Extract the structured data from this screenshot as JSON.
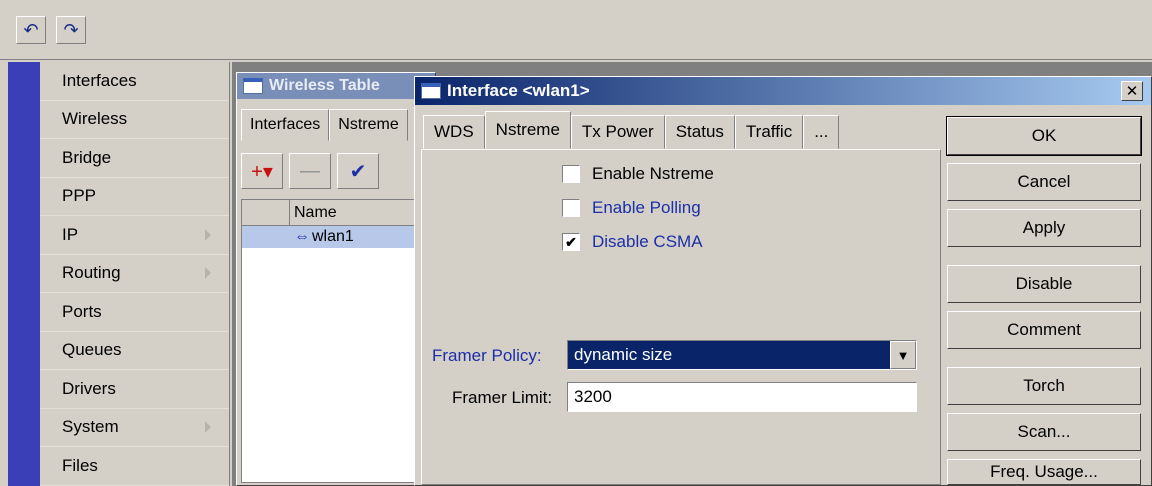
{
  "toolbar": {
    "undo_icon": "undo-icon",
    "redo_icon": "redo-icon",
    "undo_glyph": "↶",
    "redo_glyph": "↷"
  },
  "sidebar": {
    "items": [
      {
        "label": "Interfaces",
        "submenu": false
      },
      {
        "label": "Wireless",
        "submenu": false
      },
      {
        "label": "Bridge",
        "submenu": false
      },
      {
        "label": "PPP",
        "submenu": false
      },
      {
        "label": "IP",
        "submenu": true
      },
      {
        "label": "Routing",
        "submenu": true
      },
      {
        "label": "Ports",
        "submenu": false
      },
      {
        "label": "Queues",
        "submenu": false
      },
      {
        "label": "Drivers",
        "submenu": false
      },
      {
        "label": "System",
        "submenu": true
      },
      {
        "label": "Files",
        "submenu": false
      }
    ]
  },
  "wireless_table": {
    "title": "Wireless Table",
    "tabs": [
      "Interfaces",
      "Nstreme"
    ],
    "toolbar": {
      "add": "+▾",
      "remove": "—",
      "enable": "✔"
    },
    "columns": [
      "Name"
    ],
    "rows": [
      {
        "name": "wlan1"
      }
    ]
  },
  "dialog": {
    "title": "Interface <wlan1>",
    "close": "✕",
    "tabs": [
      "WDS",
      "Nstreme",
      "Tx Power",
      "Status",
      "Traffic",
      "..."
    ],
    "active_tab": "Nstreme",
    "checkboxes": {
      "enable_nstreme": {
        "label": "Enable Nstreme",
        "checked": false
      },
      "enable_polling": {
        "label": "Enable Polling",
        "checked": false
      },
      "disable_csma": {
        "label": "Disable CSMA",
        "checked": true,
        "mark": "✔"
      }
    },
    "framer_policy": {
      "label": "Framer Policy:",
      "value": "dynamic size",
      "dropdown_glyph": "▼"
    },
    "framer_limit": {
      "label": "Framer Limit:",
      "value": "3200"
    },
    "buttons": {
      "ok": "OK",
      "cancel": "Cancel",
      "apply": "Apply",
      "disable": "Disable",
      "comment": "Comment",
      "torch": "Torch",
      "scan": "Scan...",
      "freq_usage": "Freq. Usage..."
    }
  },
  "colors": {
    "titlebar_start": "#0a246a",
    "titlebar_end": "#a6caf0",
    "accent_bar": "#3a3fb8",
    "label_blue": "#1c2ea8"
  }
}
